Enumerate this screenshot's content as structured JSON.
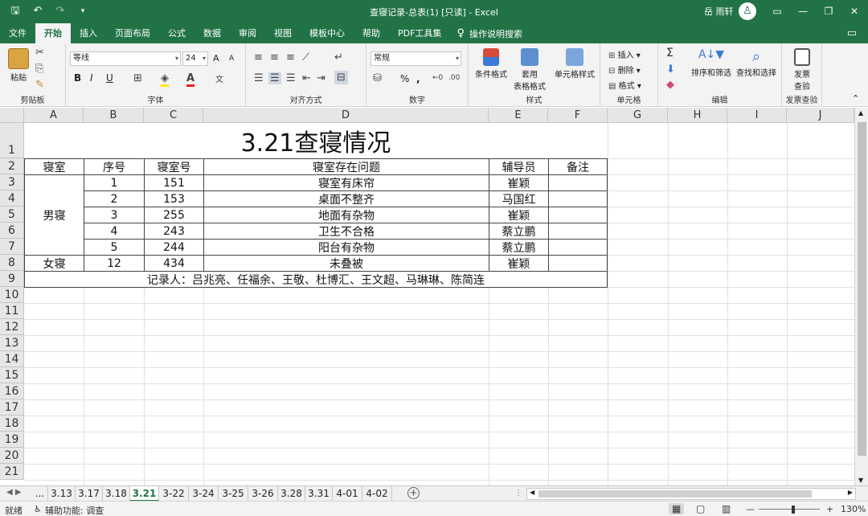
{
  "window": {
    "title": "查寝记录-总表(1)  [只读]  -  Excel",
    "user": "岳 雨轩",
    "user_initial": "♙"
  },
  "menu": {
    "tabs": [
      "文件",
      "开始",
      "插入",
      "页面布局",
      "公式",
      "数据",
      "审阅",
      "视图",
      "模板中心",
      "帮助",
      "PDF工具集"
    ],
    "active": "开始",
    "search_label": "操作说明搜索"
  },
  "ribbon": {
    "clipboard": {
      "paste": "粘贴",
      "title": "剪贴板"
    },
    "font": {
      "name": "等线",
      "size": "24",
      "bold": "B",
      "italic": "I",
      "underline": "U",
      "grow": "A",
      "shrink": "A",
      "title": "字体"
    },
    "align": {
      "title": "对齐方式"
    },
    "number": {
      "format": "常规",
      "percent": "%",
      "comma": ",",
      "title": "数字"
    },
    "styles": {
      "conditional": "条件格式",
      "table_line1": "套用",
      "table_line2": "表格格式",
      "cell_styles": "单元格样式",
      "title": "样式"
    },
    "cells": {
      "insert": "插入",
      "delete": "删除",
      "format": "格式",
      "title": "单元格"
    },
    "editing": {
      "sum": "Σ",
      "sort": "排序和筛选",
      "find": "查找和选择",
      "title": "编辑"
    },
    "invoice": {
      "line1": "发票",
      "line2": "查验",
      "title": "发票查验"
    }
  },
  "columns": [
    "A",
    "B",
    "C",
    "D",
    "E",
    "F",
    "G",
    "H",
    "I",
    "J"
  ],
  "rows": [
    "1",
    "2",
    "3",
    "4",
    "5",
    "6",
    "7",
    "8",
    "9",
    "10",
    "11",
    "12",
    "13",
    "14",
    "15",
    "16",
    "17",
    "18",
    "19",
    "20",
    "21"
  ],
  "sheet": {
    "title": "3.21查寝情况",
    "headers": [
      "寝室",
      "序号",
      "寝室号",
      "寝室存在问题",
      "辅导员",
      "备注"
    ],
    "male_label": "男寝",
    "female_label": "女寝",
    "records": [
      {
        "no": "1",
        "room": "151",
        "issue": "寝室有床帘",
        "counselor": "崔颖"
      },
      {
        "no": "2",
        "room": "153",
        "issue": "桌面不整齐",
        "counselor": "马国红"
      },
      {
        "no": "3",
        "room": "255",
        "issue": "地面有杂物",
        "counselor": "崔颖"
      },
      {
        "no": "4",
        "room": "243",
        "issue": "卫生不合格",
        "counselor": "蔡立鹏"
      },
      {
        "no": "5",
        "room": "244",
        "issue": "阳台有杂物",
        "counselor": "蔡立鹏"
      }
    ],
    "female_record": {
      "no": "12",
      "room": "434",
      "issue": "未叠被",
      "counselor": "崔颖"
    },
    "recorder": "记录人：吕兆亮、任福余、王敬、杜博汇、王文超、马琳琳、陈简连"
  },
  "sheet_tabs": [
    "...",
    "3.13",
    "3.17",
    "3.18",
    "3.21",
    "3-22",
    "3-24",
    "3-25",
    "3-26",
    "3.28",
    "3.31",
    "4-01",
    "4-02"
  ],
  "active_sheet": "3.21",
  "status": {
    "ready": "就绪",
    "accessibility": "辅助功能: 调查",
    "zoom": "130%"
  }
}
